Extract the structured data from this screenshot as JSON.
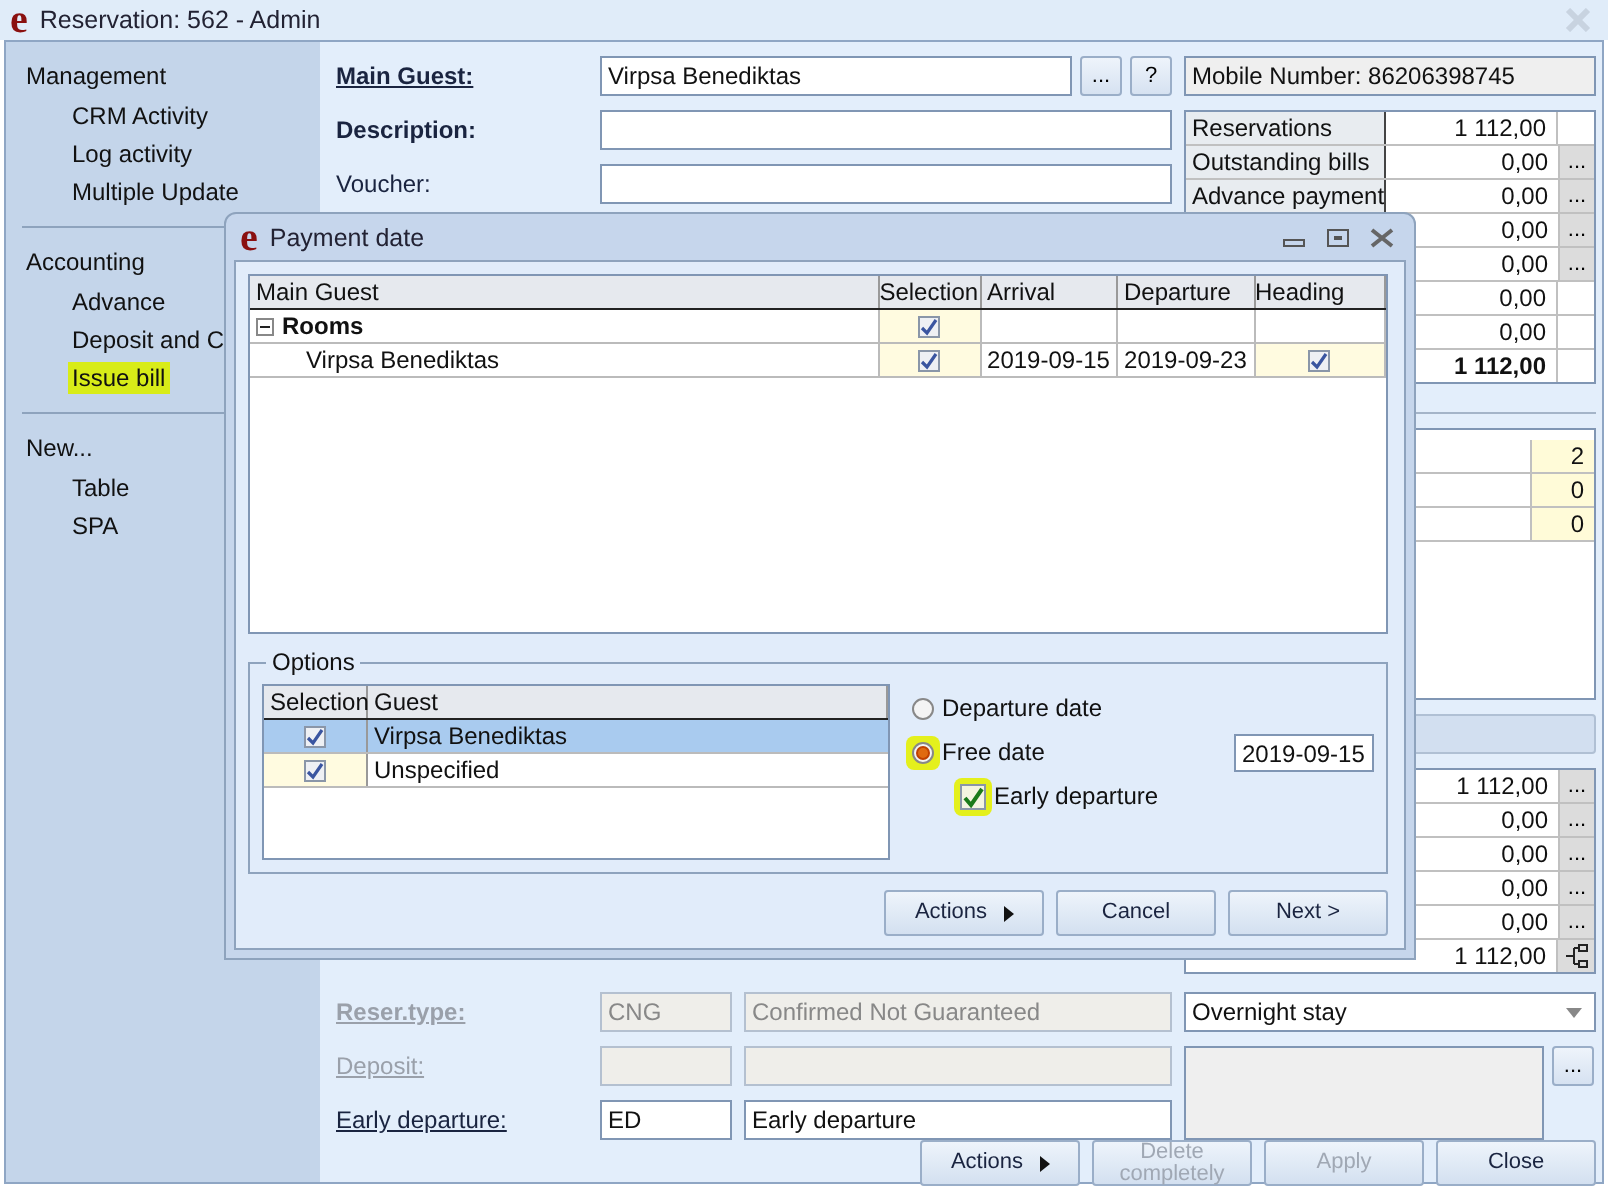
{
  "window": {
    "logo": "e",
    "title": "Reservation: 562 - Admin"
  },
  "sidebar": {
    "sections": [
      {
        "title": "Management",
        "items": [
          {
            "label": "CRM Activity",
            "highlighted": false
          },
          {
            "label": "Log activity",
            "highlighted": false
          },
          {
            "label": "Multiple Update",
            "highlighted": false
          }
        ]
      },
      {
        "title": "Accounting",
        "items": [
          {
            "label": "Advance",
            "highlighted": false
          },
          {
            "label": "Deposit and C",
            "highlighted": false
          },
          {
            "label": "Issue bill",
            "highlighted": true
          }
        ]
      },
      {
        "title": "New...",
        "items": [
          {
            "label": "Table",
            "highlighted": false
          },
          {
            "label": "SPA",
            "highlighted": false
          }
        ]
      }
    ]
  },
  "form": {
    "main_guest": {
      "label": "Main Guest:",
      "value": "Virpsa Benediktas",
      "buttons": [
        "...",
        "?"
      ]
    },
    "description": {
      "label": "Description:"
    },
    "voucher": {
      "label": "Voucher:"
    },
    "fields": [
      {
        "label": "Reser.type:",
        "disabled": true,
        "code": "CNG",
        "name": "Confirmed Not Guaranteed"
      },
      {
        "label": "Deposit:",
        "disabled": true
      },
      {
        "label": "Early departure:",
        "disabled": false,
        "code": "ED",
        "name": "Early departure"
      }
    ]
  },
  "mobile": "Mobile Number: 86206398745",
  "totals": [
    {
      "label": "Reservations",
      "value": "1 112,00",
      "bold": false
    },
    {
      "label": "Outstanding bills",
      "value": "0,00",
      "button": "...",
      "bold": false
    },
    {
      "label": "Advance payment",
      "value": "0,00",
      "button": "...",
      "bold": false
    },
    {
      "value": "0,00",
      "button": "...",
      "bold": false
    },
    {
      "value": "0,00",
      "button": "...",
      "bold": false
    },
    {
      "value": "0,00",
      "bold": false
    },
    {
      "value": "0,00",
      "bold": false
    },
    {
      "value": "1 112,00",
      "bold": true
    }
  ],
  "counts": [
    "2",
    "0",
    "0"
  ],
  "payments": [
    {
      "value": "1 112,00",
      "kind": "more",
      "button": "..."
    },
    {
      "value": "0,00",
      "kind": "more",
      "button": "..."
    },
    {
      "value": "0,00",
      "kind": "more",
      "button": "..."
    },
    {
      "value": "0,00",
      "kind": "more",
      "button": "..."
    },
    {
      "value": "0,00",
      "kind": "more",
      "button": "..."
    },
    {
      "value": "1 112,00",
      "kind": "tree"
    }
  ],
  "stay_type": "Overnight stay",
  "memo": {
    "button": "..."
  },
  "actions": [
    {
      "label": "Actions",
      "kind": "menu",
      "disabled": false
    },
    {
      "label": "Delete completely",
      "kind": "plain",
      "disabled": true
    },
    {
      "label": "Apply",
      "kind": "plain",
      "disabled": true
    },
    {
      "label": "Close",
      "kind": "plain",
      "disabled": false
    }
  ],
  "dialog": {
    "logo": "e",
    "title": "Payment date",
    "grid": {
      "columns": [
        "Main Guest",
        "Selection",
        "Arrival",
        "Departure",
        "Heading"
      ],
      "rows": [
        {
          "name": "Rooms",
          "kind": "group",
          "expanded": true,
          "selection": true
        },
        {
          "name": "Virpsa Benediktas",
          "kind": "item",
          "selection": true,
          "arrival": "2019-09-15",
          "departure": "2019-09-23",
          "heading": true
        }
      ]
    },
    "options": {
      "title": "Options",
      "columns": [
        "Selection",
        "Guest"
      ],
      "guests": [
        {
          "name": "Virpsa Benediktas",
          "checked": true,
          "selected": true
        },
        {
          "name": "Unspecified",
          "checked": true,
          "selected": false
        }
      ],
      "radios": [
        {
          "label": "Departure date",
          "selected": false,
          "highlighted": false
        },
        {
          "label": "Free date",
          "selected": true,
          "highlighted": true
        }
      ],
      "date": "2019-09-15",
      "early_departure": {
        "label": "Early departure",
        "checked": true,
        "highlighted": true
      }
    },
    "buttons": [
      {
        "label": "Actions",
        "kind": "menu"
      },
      {
        "label": "Cancel",
        "kind": "plain"
      },
      {
        "label": "Next >",
        "kind": "plain"
      }
    ]
  }
}
